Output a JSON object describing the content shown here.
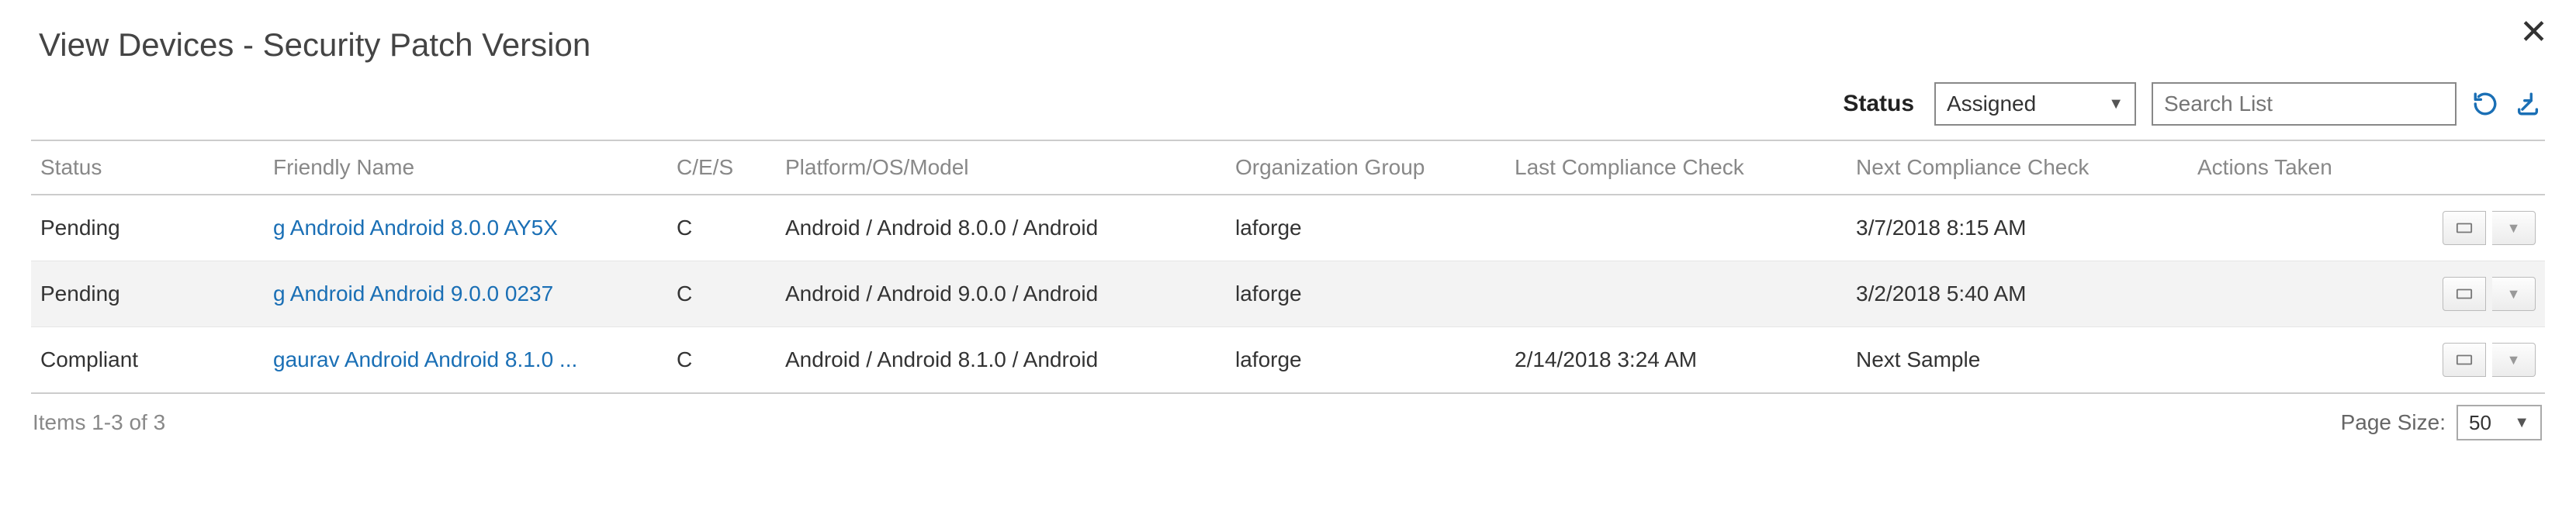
{
  "title": "View Devices - Security Patch Version",
  "filter": {
    "status_label": "Status",
    "status_value": "Assigned",
    "search_placeholder": "Search List"
  },
  "table": {
    "headers": {
      "status": "Status",
      "friendly_name": "Friendly Name",
      "ces": "C/E/S",
      "platform": "Platform/OS/Model",
      "org": "Organization Group",
      "last_check": "Last Compliance Check",
      "next_check": "Next Compliance Check",
      "actions": "Actions Taken"
    },
    "rows": [
      {
        "status": "Pending",
        "friendly_name": "g Android Android 8.0.0 AY5X",
        "ces": "C",
        "platform": "Android / Android 8.0.0 / Android",
        "org": "laforge",
        "last_check": "",
        "next_check": "3/7/2018 8:15 AM",
        "actions": ""
      },
      {
        "status": "Pending",
        "friendly_name": "g Android Android 9.0.0 0237",
        "ces": "C",
        "platform": "Android / Android 9.0.0 / Android",
        "org": "laforge",
        "last_check": "",
        "next_check": "3/2/2018 5:40 AM",
        "actions": ""
      },
      {
        "status": "Compliant",
        "friendly_name": "gaurav Android Android 8.1.0 ...",
        "ces": "C",
        "platform": "Android / Android 8.1.0 / Android",
        "org": "laforge",
        "last_check": "2/14/2018 3:24 AM",
        "next_check": "Next Sample",
        "actions": ""
      }
    ]
  },
  "footer": {
    "items_text": "Items 1-3 of 3",
    "page_size_label": "Page Size:",
    "page_size_value": "50"
  }
}
